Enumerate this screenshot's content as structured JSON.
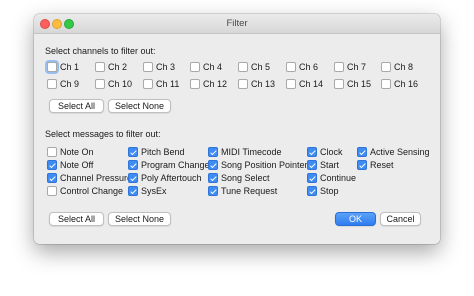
{
  "window": {
    "title": "Filter"
  },
  "channels": {
    "label": "Select channels to filter out:",
    "items": [
      {
        "label": "Ch 1",
        "checked": false
      },
      {
        "label": "Ch 2",
        "checked": false
      },
      {
        "label": "Ch 3",
        "checked": false
      },
      {
        "label": "Ch 4",
        "checked": false
      },
      {
        "label": "Ch 5",
        "checked": false
      },
      {
        "label": "Ch 6",
        "checked": false
      },
      {
        "label": "Ch 7",
        "checked": false
      },
      {
        "label": "Ch 8",
        "checked": false
      },
      {
        "label": "Ch 9",
        "checked": false
      },
      {
        "label": "Ch 10",
        "checked": false
      },
      {
        "label": "Ch 11",
        "checked": false
      },
      {
        "label": "Ch 12",
        "checked": false
      },
      {
        "label": "Ch 13",
        "checked": false
      },
      {
        "label": "Ch 14",
        "checked": false
      },
      {
        "label": "Ch 15",
        "checked": false
      },
      {
        "label": "Ch 16",
        "checked": false
      }
    ],
    "select_all": "Select All",
    "select_none": "Select None"
  },
  "messages": {
    "label": "Select messages to filter out:",
    "items": [
      {
        "label": "Note On",
        "checked": false
      },
      {
        "label": "Note Off",
        "checked": true
      },
      {
        "label": "Channel Pressure",
        "checked": true
      },
      {
        "label": "Control Change",
        "checked": false
      },
      {
        "label": "Pitch Bend",
        "checked": true
      },
      {
        "label": "Program Change",
        "checked": true
      },
      {
        "label": "Poly Aftertouch",
        "checked": true
      },
      {
        "label": "SysEx",
        "checked": true
      },
      {
        "label": "MIDI Timecode",
        "checked": true
      },
      {
        "label": "Song Position Pointer",
        "checked": true
      },
      {
        "label": "Song Select",
        "checked": true
      },
      {
        "label": "Tune Request",
        "checked": true
      },
      {
        "label": "Clock",
        "checked": true
      },
      {
        "label": "Start",
        "checked": true
      },
      {
        "label": "Continue",
        "checked": true
      },
      {
        "label": "Stop",
        "checked": true
      },
      {
        "label": "Active Sensing",
        "checked": true
      },
      {
        "label": "Reset",
        "checked": true
      }
    ],
    "select_all": "Select All",
    "select_none": "Select None"
  },
  "footer": {
    "ok": "OK",
    "cancel": "Cancel"
  },
  "colors": {
    "accent": "#3f8cf3",
    "window_bg": "#ececec"
  }
}
